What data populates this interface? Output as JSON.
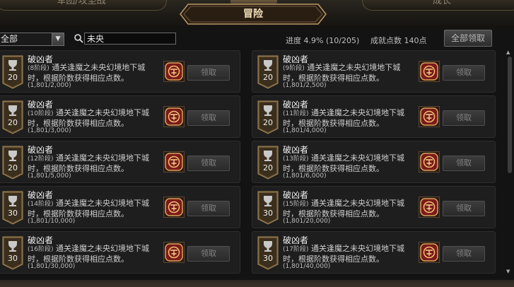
{
  "tabs": {
    "left": "军团/攻坚战",
    "center": "冒险",
    "right": "成长"
  },
  "filter": {
    "value": "全部"
  },
  "search": {
    "value": "未央"
  },
  "progress": {
    "label": "进度",
    "percent": "4.9%",
    "detail": "(10/205)"
  },
  "points": {
    "label": "成就点数",
    "value": "140点"
  },
  "claim_all_label": "全部领取",
  "achievements": [
    {
      "title": "破凶者",
      "stage": "(8阶段)",
      "desc": "通关逢魔之未央幻境地下城时，根据阶数获得相应点数。",
      "progress": "(1,801/2,000)",
      "points": "20",
      "claim": "领取"
    },
    {
      "title": "破凶者",
      "stage": "(9阶段)",
      "desc": "通关逢魔之未央幻境地下城时，根据阶数获得相应点数。",
      "progress": "(1,801/2,500)",
      "points": "20",
      "claim": "领取"
    },
    {
      "title": "破凶者",
      "stage": "(10阶段)",
      "desc": "通关逢魔之未央幻境地下城时，根据阶数获得相应点数。",
      "progress": "(1,801/3,000)",
      "points": "20",
      "claim": "领取"
    },
    {
      "title": "破凶者",
      "stage": "(11阶段)",
      "desc": "通关逢魔之未央幻境地下城时，根据阶数获得相应点数。",
      "progress": "(1,801/4,000)",
      "points": "20",
      "claim": "领取"
    },
    {
      "title": "破凶者",
      "stage": "(12阶段)",
      "desc": "通关逢魔之未央幻境地下城时，根据阶数获得相应点数。",
      "progress": "(1,801/5,000)",
      "points": "20",
      "claim": "领取"
    },
    {
      "title": "破凶者",
      "stage": "(13阶段)",
      "desc": "通关逢魔之未央幻境地下城时，根据阶数获得相应点数。",
      "progress": "(1,801/6,000)",
      "points": "20",
      "claim": "领取"
    },
    {
      "title": "破凶者",
      "stage": "(14阶段)",
      "desc": "通关逢魔之未央幻境地下城时，根据阶数获得相应点数。",
      "progress": "(1,801/10,000)",
      "points": "30",
      "claim": "领取"
    },
    {
      "title": "破凶者",
      "stage": "(15阶段)",
      "desc": "通关逢魔之未央幻境地下城时，根据阶数获得相应点数。",
      "progress": "(1,801/20,000)",
      "points": "30",
      "claim": "领取"
    },
    {
      "title": "破凶者",
      "stage": "(16阶段)",
      "desc": "通关逢魔之未央幻境地下城时，根据阶数获得相应点数。",
      "progress": "(1,801/30,000)",
      "points": "30",
      "claim": "领取"
    },
    {
      "title": "破凶者",
      "stage": "(17阶段)",
      "desc": "通关逢魔之未央幻境地下城时，根据阶数获得相应点数。",
      "progress": "(1,801/40,000)",
      "points": "30",
      "claim": "领取"
    }
  ]
}
